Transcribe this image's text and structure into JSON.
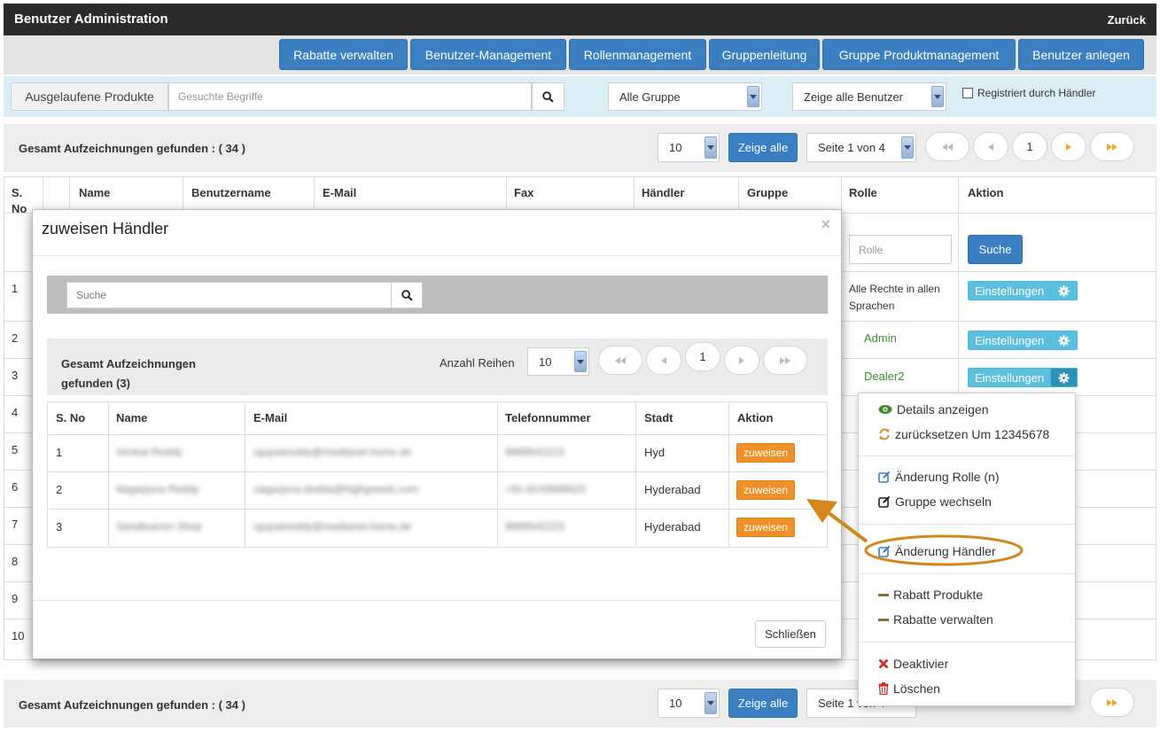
{
  "header": {
    "title": "Benutzer Administration",
    "back": "Zurück"
  },
  "nav": [
    "Rabatte verwalten",
    "Benutzer-Management",
    "Rollenmanagement",
    "Gruppenleitung",
    "Gruppe Produktmanagement",
    "Benutzer anlegen"
  ],
  "filter": {
    "expired_label": "Ausgelaufene Produkte",
    "search_placeholder": "Gesuchte Begriffe",
    "group_select": "Alle Gruppe",
    "user_select": "Zeige alle Benutzer",
    "registered_label": "Registriert durch Händler"
  },
  "pagination": {
    "total_label": "Gesamt Aufzeichnungen gefunden : ( 34 )",
    "per_page": "10",
    "show_all": "Zeige alle",
    "page_select": "Seite 1 von 4",
    "current_page": "1"
  },
  "table": {
    "headers": [
      "S.\nNo",
      "Name",
      "Benutzername",
      "E-Mail",
      "Fax",
      "Händler",
      "Gruppe",
      "Rolle",
      "Aktion"
    ],
    "role_placeholder": "Rolle",
    "search_button": "Suche",
    "row_numbers": [
      "1",
      "2",
      "3",
      "4",
      "5",
      "6",
      "7",
      "8",
      "9",
      "10"
    ],
    "roles": [
      "Alle Rechte in allen Sprachen",
      "Admin",
      "Dealer2"
    ],
    "settings_label": "Einstellungen"
  },
  "modal": {
    "title": "zuweisen Händler",
    "close_x": "×",
    "search_placeholder": "Suche",
    "total_label": "Gesamt Aufzeichnungen gefunden (3)",
    "rows_label": "Anzahl Reihen",
    "rows_per_page": "10",
    "current_page": "1",
    "headers": [
      "S. No",
      "Name",
      "E-Mail",
      "Telefonnummer",
      "Stadt",
      "Aktion"
    ],
    "rows": [
      {
        "no": "1",
        "name": "Venkat Reddy",
        "email": "rgujulareddy@medianet-home.de",
        "phone": "9989542223",
        "city": "Hyd",
        "action": "zuweisen"
      },
      {
        "no": "2",
        "name": "Nagarjuna Reddy",
        "email": "nagarjuna.dodda@highgoweb.com",
        "phone": "+91-8143686620",
        "city": "Hyderabad",
        "action": "zuweisen"
      },
      {
        "no": "3",
        "name": "Sandbueren Shop",
        "email": "rgujulareddy@medianet-home.de",
        "phone": "9989542223",
        "city": "Hyderabad",
        "action": "zuweisen"
      }
    ],
    "close_button": "Schließen"
  },
  "menu": {
    "details": "Details anzeigen",
    "reset": "zurücksetzen Um 12345678",
    "change_role": "Änderung Rolle (n)",
    "change_group": "Gruppe wechseln",
    "change_dealer": "Änderung Händler",
    "discount_products": "Rabatt Produkte",
    "manage_discounts": "Rabatte verwalten",
    "deactivate": "Deaktivier",
    "delete": "Löschen"
  },
  "colors": {
    "primary": "#3a7fc1",
    "info": "#5bc0de",
    "warning": "#f0902a",
    "annotation": "#d4861a",
    "header_bg": "#2b2b2b"
  }
}
